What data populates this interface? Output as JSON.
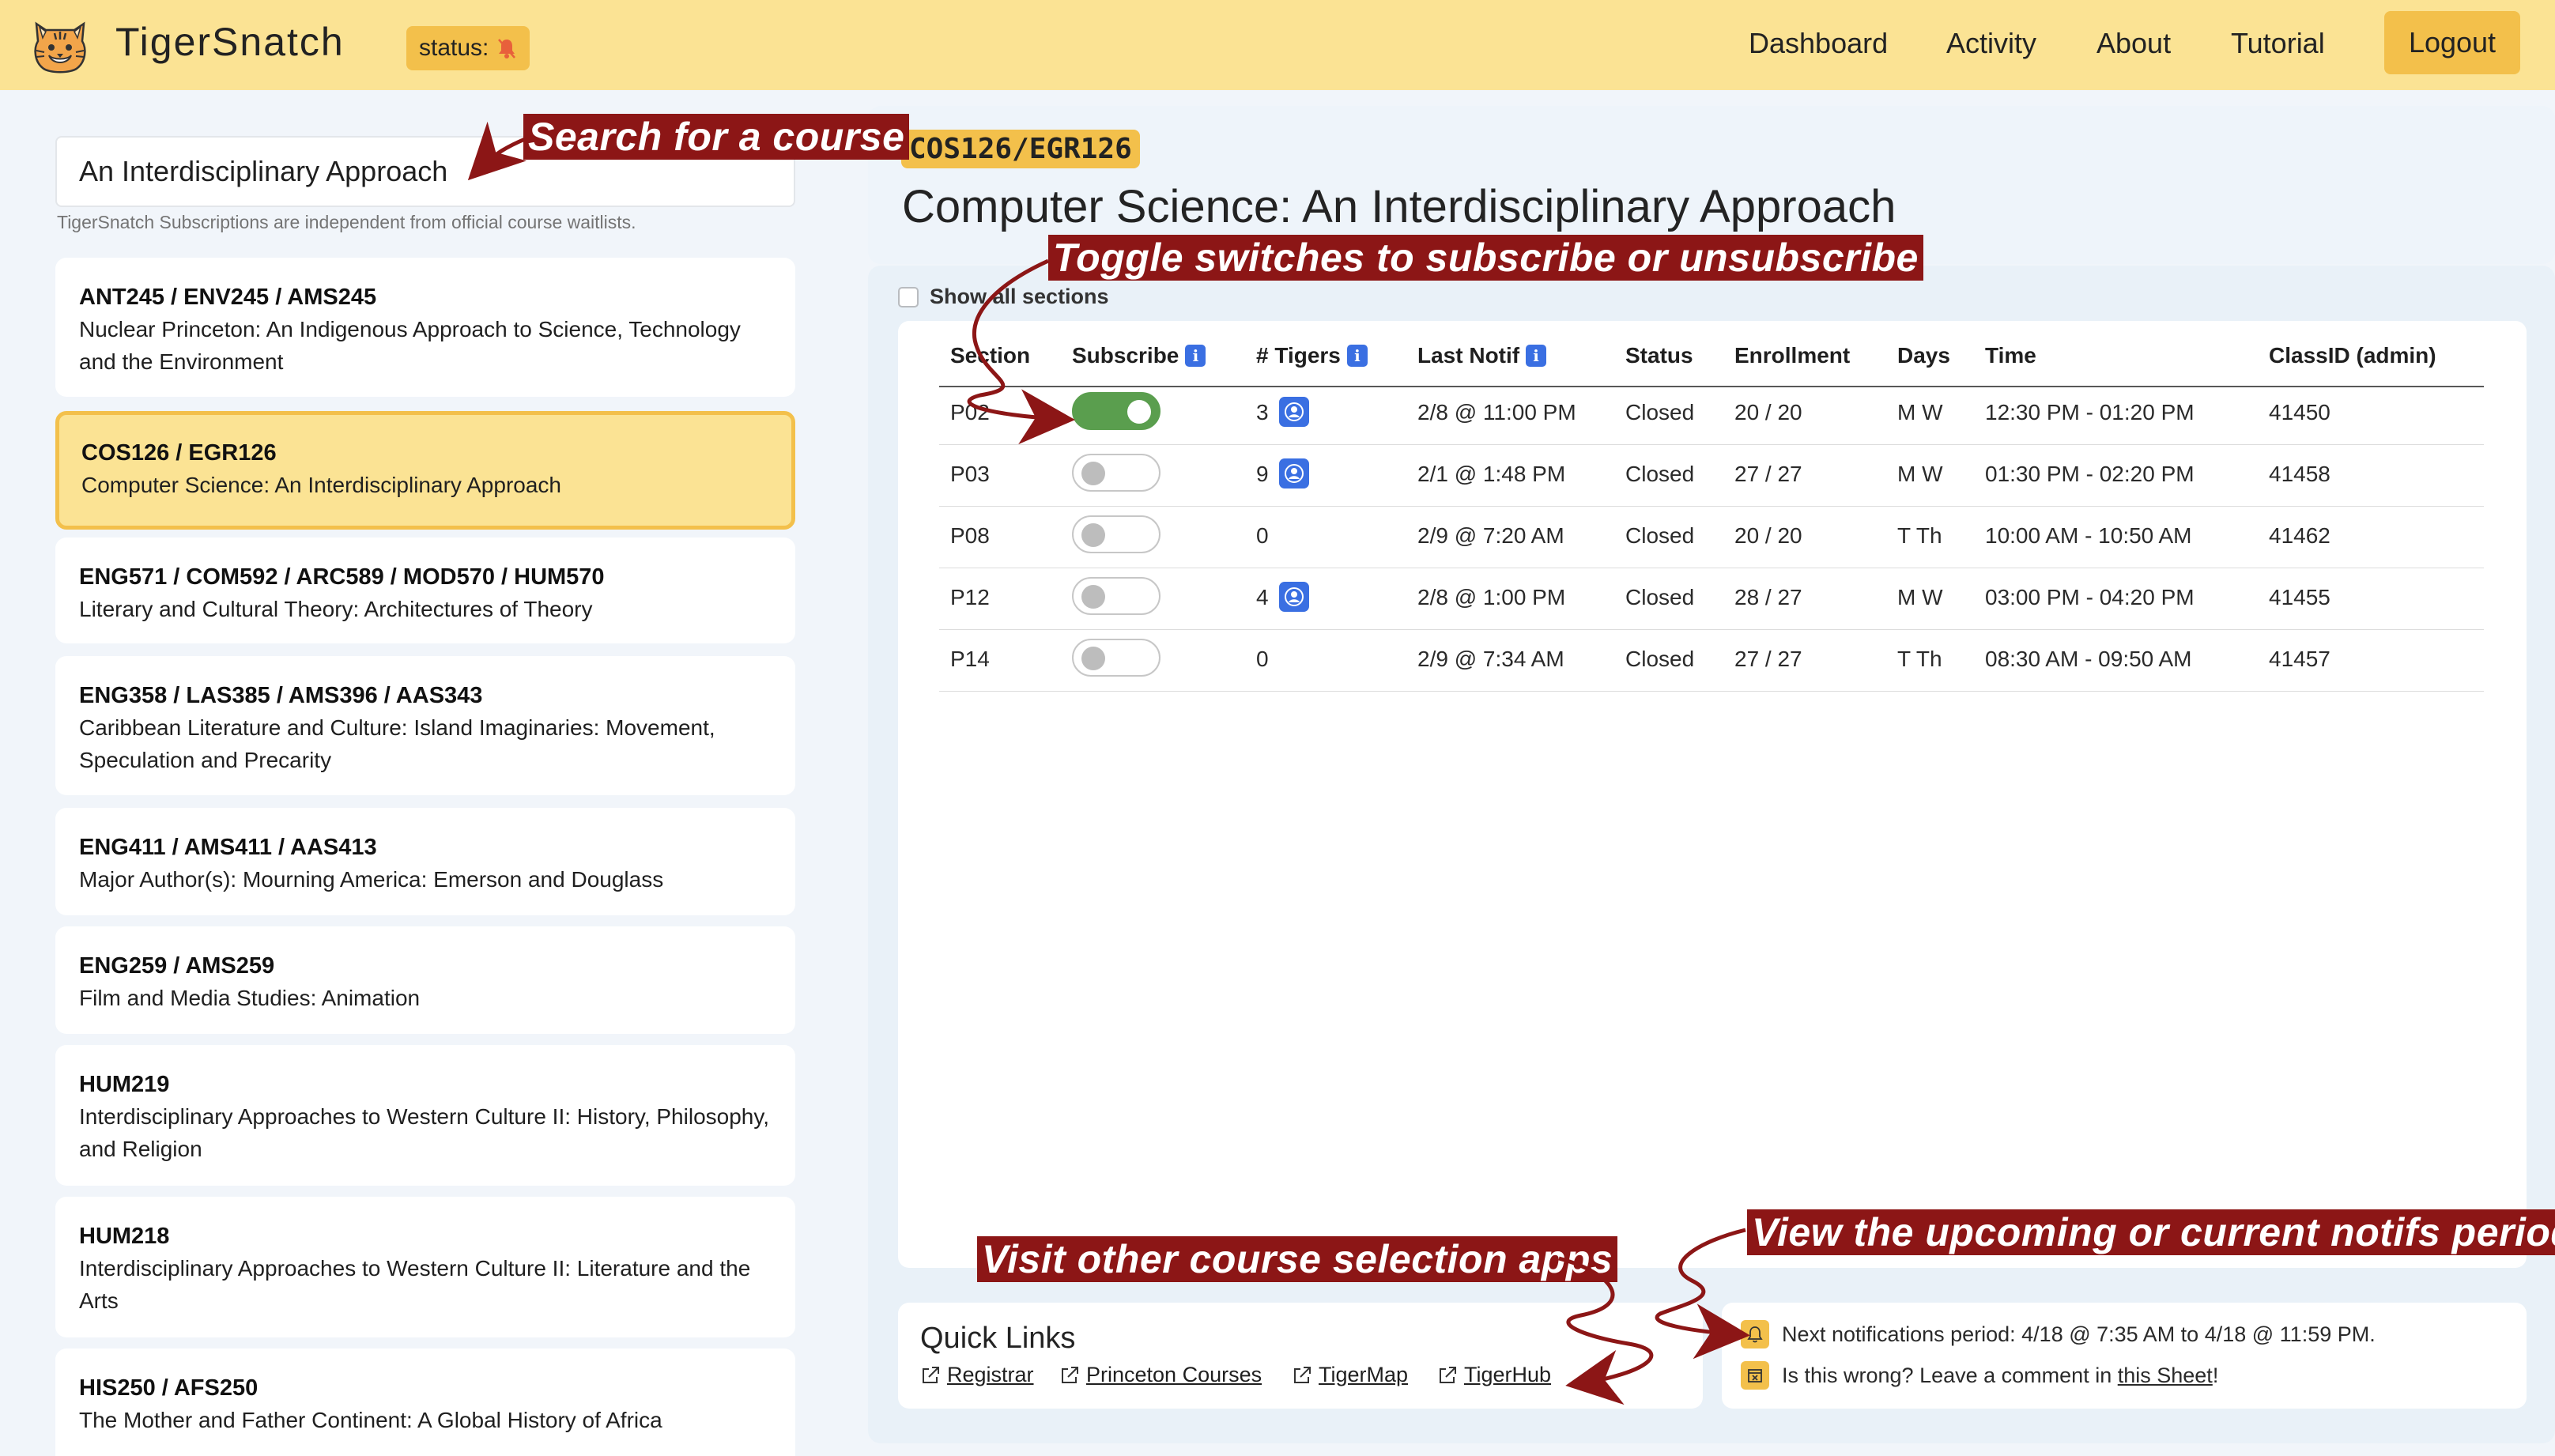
{
  "navbar": {
    "brand": "TigerSnatch",
    "status_label": "status:",
    "status_icon": "bell-slash-icon",
    "links": [
      "Dashboard",
      "Activity",
      "About",
      "Tutorial"
    ],
    "logout": "Logout"
  },
  "search": {
    "value": "An Interdisciplinary Approach",
    "note": "TigerSnatch Subscriptions are independent from official course waitlists."
  },
  "courses": [
    {
      "code": "ANT245 / ENV245 / AMS245",
      "title": "Nuclear Princeton: An Indigenous Approach to Science, Technology and the Environment"
    },
    {
      "code": "COS126 / EGR126",
      "title": "Computer Science: An Interdisciplinary Approach"
    },
    {
      "code": "ENG571 / COM592 / ARC589 / MOD570 / HUM570",
      "title": "Literary and Cultural Theory: Architectures of Theory"
    },
    {
      "code": "ENG358 / LAS385 / AMS396 / AAS343",
      "title": "Caribbean Literature and Culture: Island Imaginaries: Movement, Speculation and Precarity"
    },
    {
      "code": "ENG411 / AMS411 / AAS413",
      "title": "Major Author(s): Mourning America: Emerson and Douglass"
    },
    {
      "code": "ENG259 / AMS259",
      "title": "Film and Media Studies: Animation"
    },
    {
      "code": "HUM219",
      "title": "Interdisciplinary Approaches to Western Culture II: History, Philosophy, and Religion"
    },
    {
      "code": "HUM218",
      "title": "Interdisciplinary Approaches to Western Culture II: Literature and the Arts"
    },
    {
      "code": "HIS250 / AFS250",
      "title": "The Mother and Father Continent: A Global History of Africa"
    }
  ],
  "selected_course": {
    "code": "COS126/EGR126",
    "title": "Computer Science: An Interdisciplinary Approach"
  },
  "show_all_label": "Show all sections",
  "table": {
    "headers": [
      "Section",
      "Subscribe",
      "# Tigers",
      "Last Notif",
      "Status",
      "Enrollment",
      "Days",
      "Time",
      "ClassID (admin)"
    ],
    "rows": [
      {
        "section": "P02",
        "subscribed": true,
        "tigers": "3",
        "has_tigers": true,
        "last_notif": "2/8 @ 11:00 PM",
        "status": "Closed",
        "enrollment": "20 / 20",
        "days": "M W",
        "time": "12:30 PM - 01:20 PM",
        "classid": "41450"
      },
      {
        "section": "P03",
        "subscribed": false,
        "tigers": "9",
        "has_tigers": true,
        "last_notif": "2/1 @ 1:48 PM",
        "status": "Closed",
        "enrollment": "27 / 27",
        "days": "M W",
        "time": "01:30 PM - 02:20 PM",
        "classid": "41458"
      },
      {
        "section": "P08",
        "subscribed": false,
        "tigers": "0",
        "has_tigers": false,
        "last_notif": "2/9 @ 7:20 AM",
        "status": "Closed",
        "enrollment": "20 / 20",
        "days": "T Th",
        "time": "10:00 AM - 10:50 AM",
        "classid": "41462"
      },
      {
        "section": "P12",
        "subscribed": false,
        "tigers": "4",
        "has_tigers": true,
        "last_notif": "2/8 @ 1:00 PM",
        "status": "Closed",
        "enrollment": "28 / 27",
        "days": "M W",
        "time": "03:00 PM - 04:20 PM",
        "classid": "41455"
      },
      {
        "section": "P14",
        "subscribed": false,
        "tigers": "0",
        "has_tigers": false,
        "last_notif": "2/9 @ 7:34 AM",
        "status": "Closed",
        "enrollment": "27 / 27",
        "days": "T Th",
        "time": "08:30 AM - 09:50 AM",
        "classid": "41457"
      }
    ]
  },
  "quick_links": {
    "title": "Quick Links",
    "links": [
      "Registrar",
      "Princeton Courses",
      "TigerMap",
      "TigerHub"
    ]
  },
  "notifs": {
    "next_period": "Next notifications period: 4/18 @ 7:35 AM to 4/18 @ 11:59 PM.",
    "wrong_prefix": "Is this wrong? Leave a comment in",
    "sheet_link": "this Sheet",
    "wrong_suffix": "!"
  },
  "annotations": {
    "search": "Search for a course",
    "toggle": "Toggle switches to subscribe or unsubscribe",
    "quick": "Visit other course selection apps",
    "notifs": "View the upcoming or current notifs period"
  },
  "colors": {
    "navbar": "#fbe394",
    "accent": "#f3c04b",
    "toggle_on": "#5a9e4e",
    "info_blue": "#3a6fe2",
    "annotation": "#8c1616"
  }
}
